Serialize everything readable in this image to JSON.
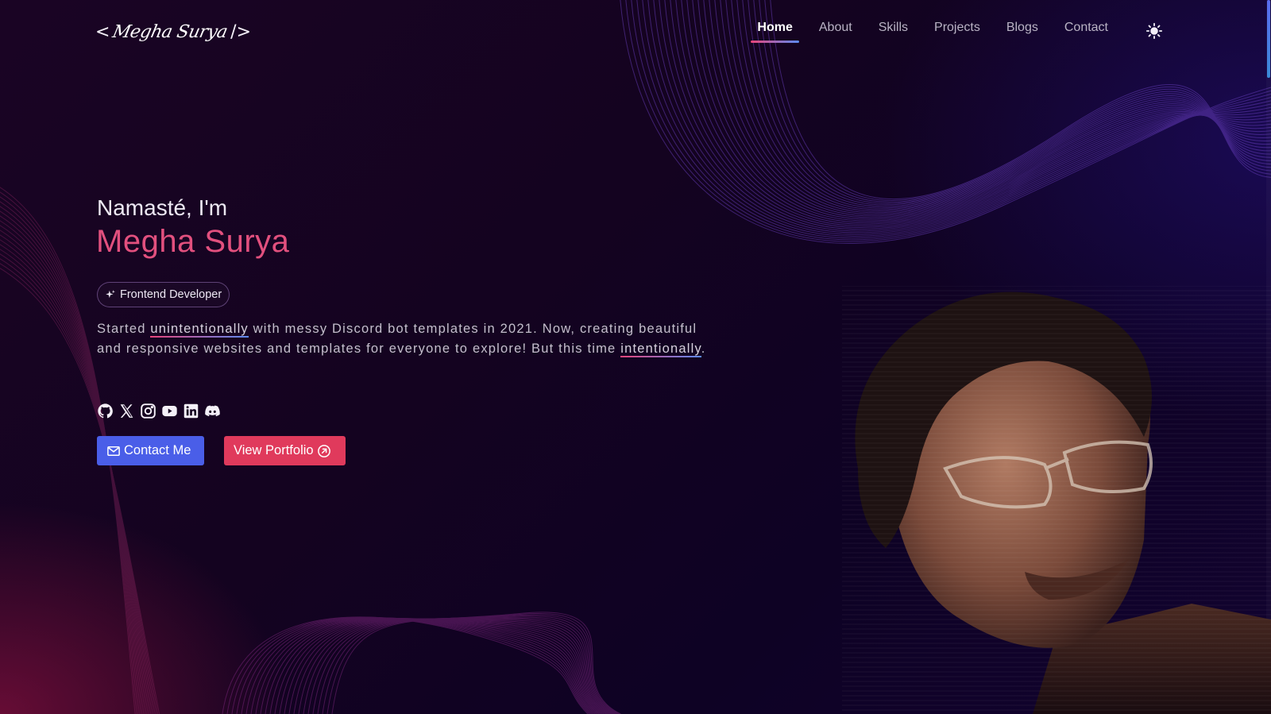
{
  "nav": {
    "logo": {
      "bracket_open": "<",
      "signature": "Megha Surya",
      "bracket_close": "/>"
    },
    "links": [
      {
        "label": "Home",
        "active": true
      },
      {
        "label": "About",
        "active": false
      },
      {
        "label": "Skills",
        "active": false
      },
      {
        "label": "Projects",
        "active": false
      },
      {
        "label": "Blogs",
        "active": false
      },
      {
        "label": "Contact",
        "active": false
      }
    ],
    "theme_toggle_icon": "sun-icon"
  },
  "hero": {
    "greeting": "Namasté, I'm",
    "name": "Megha Surya",
    "role_badge": {
      "icon": "sparkles-icon",
      "label": "Frontend Developer"
    },
    "bio": {
      "part1": "Started ",
      "link1": "unintentionally",
      "part2": " with messy Discord bot templates in 2021. Now, creating beautiful and responsive websites and templates for everyone to explore! But this time ",
      "link2": "intentionally",
      "part3": "."
    },
    "socials": [
      "github-icon",
      "x-icon",
      "instagram-icon",
      "youtube-icon",
      "linkedin-icon",
      "discord-icon"
    ],
    "buttons": {
      "contact": {
        "label": "Contact Me",
        "icon": "mail-icon"
      },
      "portfolio": {
        "label": "View Portfolio",
        "icon": "arrow-up-right-circle-icon"
      }
    }
  },
  "colors": {
    "accent_pink": "#e2507e",
    "accent_blue": "#4a5ee8",
    "portfolio_red": "#e03a5c",
    "background": "#140320"
  }
}
